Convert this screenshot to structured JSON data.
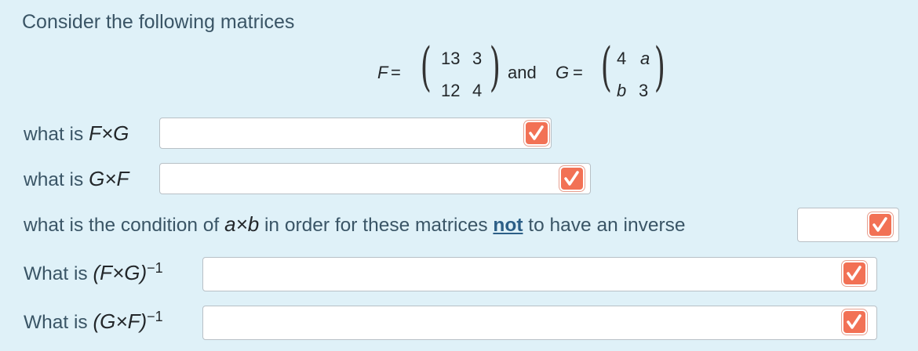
{
  "intro": "Consider the following matrices",
  "matrices": {
    "F_label": "F",
    "eq": "=",
    "F": [
      [
        "13",
        "3"
      ],
      [
        "12",
        "4"
      ]
    ],
    "and": "and",
    "G_label": "G",
    "G": [
      [
        "4",
        "a"
      ],
      [
        "b",
        "3"
      ]
    ]
  },
  "questions": [
    {
      "prefix": "what is",
      "expr": "F×G"
    },
    {
      "prefix": "what is",
      "expr": "G×F"
    },
    {
      "prefix": "what is the condition of",
      "expr": "a×b",
      "mid": "in order for these matrices",
      "emph": "not",
      "suffix": "to have an inverse"
    },
    {
      "prefix": "What is",
      "expr": "(F×G)",
      "sup": "−1"
    },
    {
      "prefix": "What is",
      "expr": "(G×F)",
      "sup": "−1"
    }
  ],
  "colors": {
    "background": "#dff1f8",
    "check_button": "#f27155"
  },
  "icons": {
    "check": "checkmark-icon"
  }
}
